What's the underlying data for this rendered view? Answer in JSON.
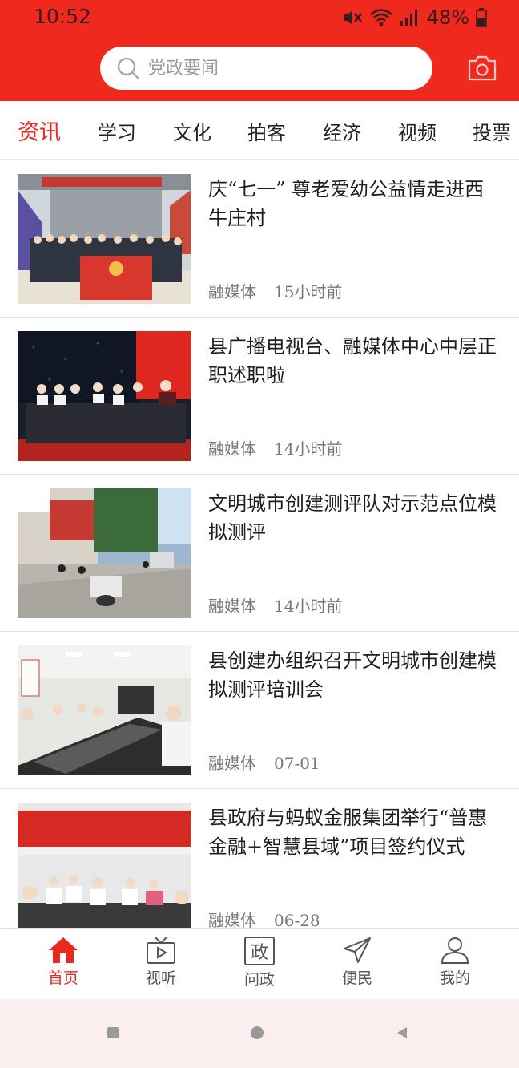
{
  "status_bar": {
    "time": "10:52",
    "battery": "48%"
  },
  "search": {
    "placeholder": "党政要闻"
  },
  "tabs": [
    "资讯",
    "学习",
    "文化",
    "拍客",
    "经济",
    "视频",
    "投票"
  ],
  "news": [
    {
      "title": "庆“七一” 尊老爱幼公益情走进西牛庄村",
      "source": "融媒体",
      "time": "15小时前"
    },
    {
      "title": "县广播电视台、融媒体中心中层正职述职啦",
      "source": "融媒体",
      "time": "14小时前"
    },
    {
      "title": "文明城市创建测评队对示范点位模拟测评",
      "source": "融媒体",
      "time": "14小时前"
    },
    {
      "title": "县创建办组织召开文明城市创建模拟测评培训会",
      "source": "融媒体",
      "time": "07-01"
    },
    {
      "title": "县政府与蚂蚁金服集团举行“普惠金融+智慧县域”项目签约仪式",
      "source": "融媒体",
      "time": "06-28"
    }
  ],
  "bottom_nav": [
    "首页",
    "视听",
    "问政",
    "便民",
    "我的"
  ],
  "colors": {
    "accent": "#f0291f",
    "active_text": "#e8291f"
  }
}
